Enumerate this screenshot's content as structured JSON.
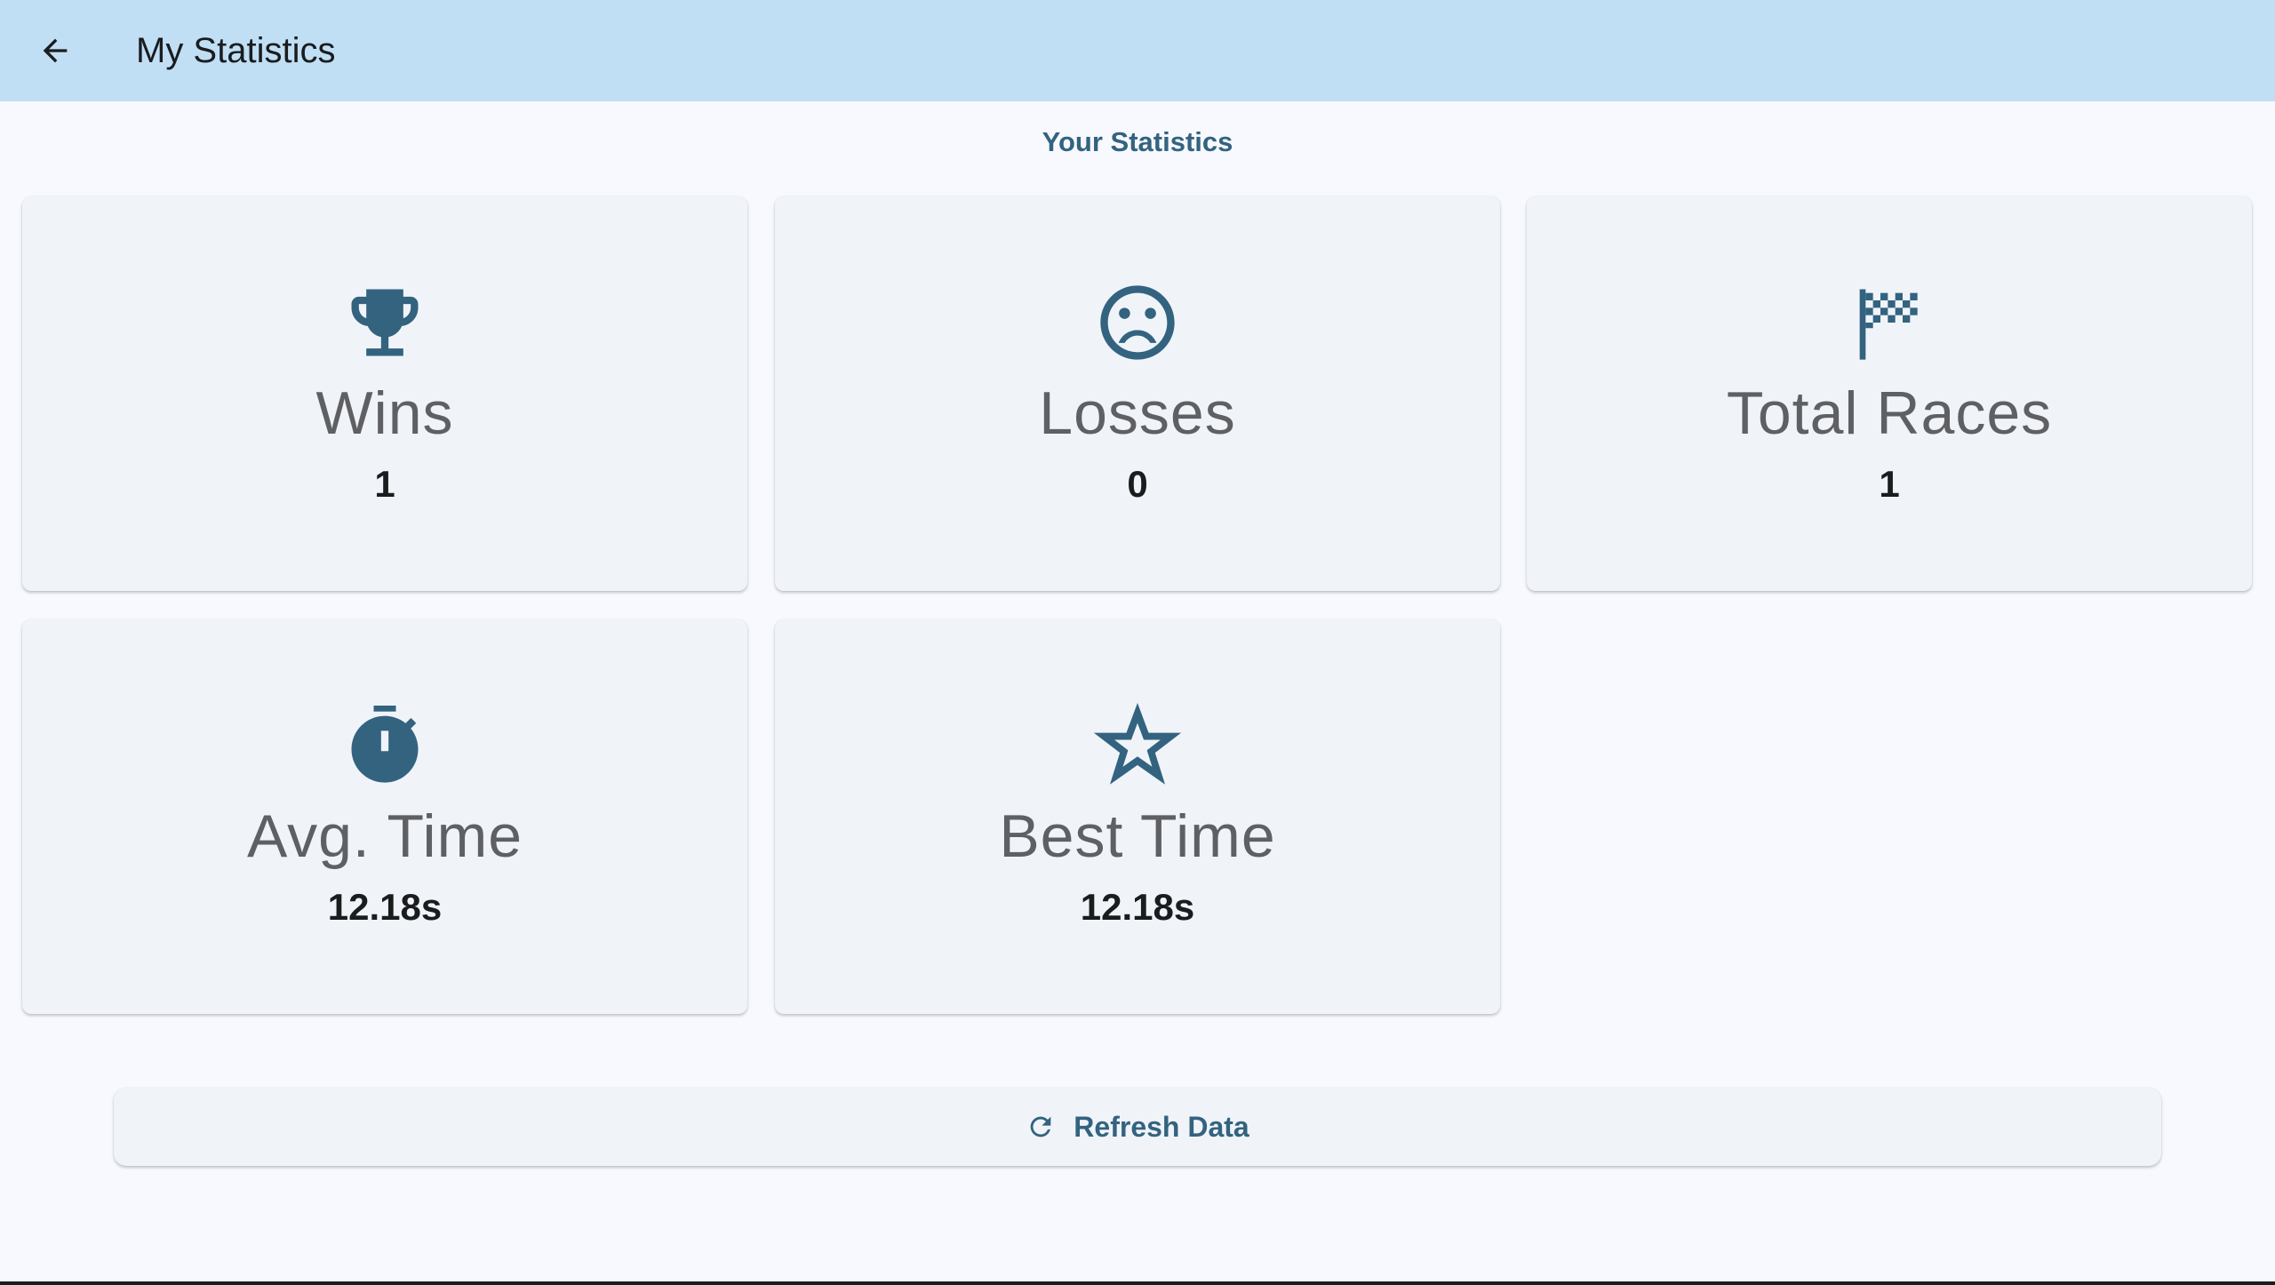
{
  "app_bar": {
    "title": "My Statistics",
    "back_icon": "arrow-back-icon"
  },
  "heading": "Your Statistics",
  "stats": [
    {
      "icon": "trophy-icon",
      "label": "Wins",
      "value": "1"
    },
    {
      "icon": "sad-face-icon",
      "label": "Losses",
      "value": "0"
    },
    {
      "icon": "checkered-flag-icon",
      "label": "Total Races",
      "value": "1"
    },
    {
      "icon": "stopwatch-icon",
      "label": "Avg. Time",
      "value": "12.18s"
    },
    {
      "icon": "star-outline-icon",
      "label": "Best Time",
      "value": "12.18s"
    }
  ],
  "refresh_button": {
    "icon": "refresh-icon",
    "label": "Refresh Data"
  },
  "colors": {
    "app_bar": "#c0dff5",
    "accent": "#33637f",
    "card_bg": "#f0f4f9",
    "page_bg": "#f7f9ff"
  }
}
